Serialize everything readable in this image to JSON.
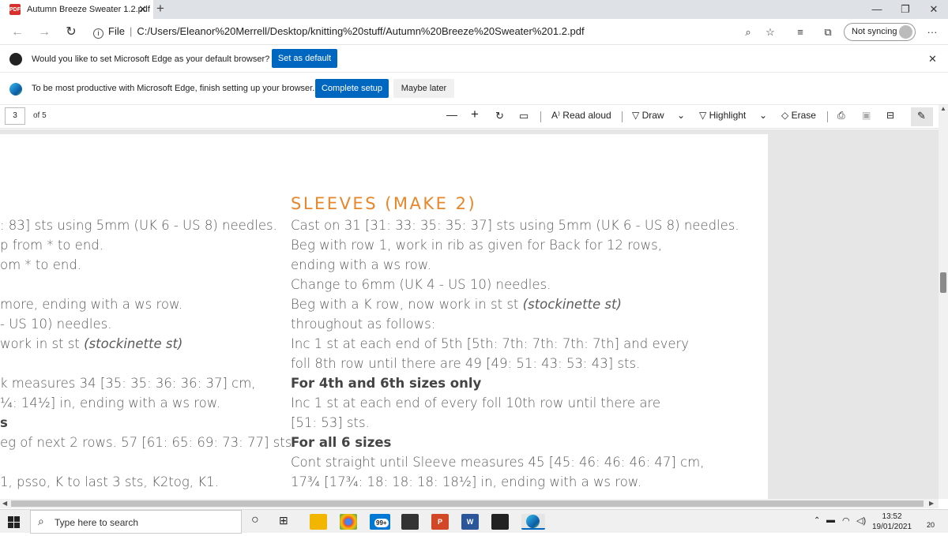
{
  "tab": {
    "title": "Autumn Breeze Sweater 1.2.pdf",
    "favicon": "PDF",
    "close": "✕",
    "new_tab": "+"
  },
  "window": {
    "minimize": "—",
    "restore": "❐",
    "close": "✕"
  },
  "address": {
    "protocol_label": "File",
    "url": "C:/Users/Eleanor%20Merrell/Desktop/knitting%20stuff/Autumn%20Breeze%20Sweater%201.2.pdf",
    "sync_label": "Not syncing",
    "more": "···"
  },
  "infobar_default": {
    "message": "Would you like to set Microsoft Edge as your default browser?",
    "button": "Set as default",
    "close": "✕"
  },
  "infobar_setup": {
    "message": "To be most productive with Microsoft Edge, finish setting up your browser.",
    "primary": "Complete setup",
    "secondary": "Maybe later"
  },
  "pdf_toolbar": {
    "page_number": "3",
    "page_count": "of 5",
    "zoom_out": "—",
    "zoom_in": "+",
    "read_aloud": "Read aloud",
    "draw": "Draw",
    "highlight": "Highlight",
    "erase": "Erase"
  },
  "document": {
    "heading": "SLEEVES (MAKE 2)",
    "left_lines": [
      ": 83] sts using 5mm (UK 6 - US 8) needles.",
      "p from * to end.",
      "om * to end.",
      "",
      " more, ending with a ws row.",
      " - US 10) needles.",
      " work in st st ",
      "",
      "k measures 34 [35: 35: 36: 36: 37] cm,",
      "¼: 14½] in, ending with a ws row.",
      "s",
      "eg of next 2 rows. 57 [61: 65: 69: 73: 77] sts.",
      "",
      "1, psso, K to last 3 sts, K2tog, K1."
    ],
    "left_italic": "(stockinette st)",
    "right_lines": [
      "Cast on 31 [31: 33: 35: 35: 37] sts using 5mm (UK 6 - US 8) needles.",
      "Beg with row 1, work in rib as given for Back for 12 rows,",
      "ending with a ws row.",
      "Change to 6mm (UK 4 - US 10) needles.",
      "Beg with a K row, now work in st st ",
      "throughout as follows:",
      "Inc 1 st at each end of 5th [5th: 7th: 7th: 7th: 7th] and every",
      "foll 8th row until there are 49 [49: 51: 43: 53: 43] sts.",
      "For 4th and 6th sizes only",
      "Inc 1 st at each end of every foll 10th row until there are",
      "[51: 53] sts.",
      "For all 6 sizes",
      "Cont straight until Sleeve measures 45 [45: 46: 46: 46: 47] cm,",
      "17¾ [17¾: 18: 18: 18: 18½] in, ending with a ws row."
    ],
    "right_italic_line5": "(stockinette st)",
    "cont_italic": "Cont straight until Sleeve measures"
  },
  "taskbar": {
    "search_placeholder": "Type here to search",
    "mail_badge": "99+",
    "time": "13:52",
    "date": "19/01/2021",
    "notif_count": "20"
  },
  "colors": {
    "heading": "#e8862a",
    "edge_blue": "#0067c0"
  }
}
